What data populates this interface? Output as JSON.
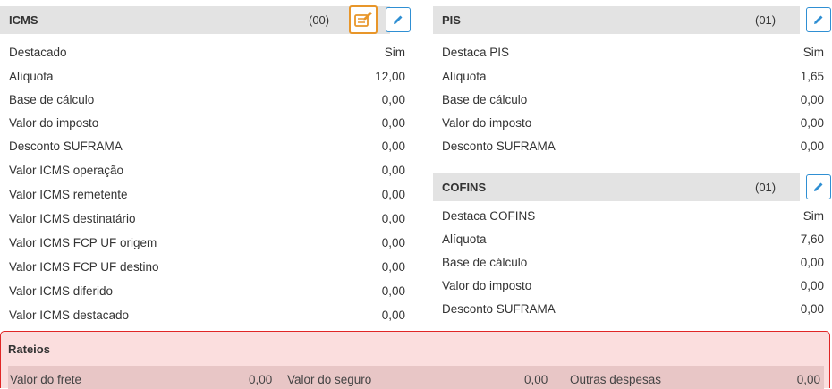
{
  "icms": {
    "title": "ICMS",
    "code": "(00)",
    "rows": [
      {
        "label": "Destacado",
        "value": "Sim"
      },
      {
        "label": "Alíquota",
        "value": "12,00"
      },
      {
        "label": "Base de cálculo",
        "value": "0,00"
      },
      {
        "label": "Valor do imposto",
        "value": "0,00"
      },
      {
        "label": "Desconto SUFRAMA",
        "value": "0,00"
      },
      {
        "label": "Valor ICMS operação",
        "value": "0,00"
      },
      {
        "label": "Valor ICMS remetente",
        "value": "0,00"
      },
      {
        "label": "Valor ICMS destinatário",
        "value": "0,00"
      },
      {
        "label": "Valor ICMS FCP UF origem",
        "value": "0,00"
      },
      {
        "label": "Valor ICMS FCP UF destino",
        "value": "0,00"
      },
      {
        "label": "Valor ICMS diferido",
        "value": "0,00"
      },
      {
        "label": "Valor ICMS destacado",
        "value": "0,00"
      }
    ]
  },
  "pis": {
    "title": "PIS",
    "code": "(01)",
    "rows": [
      {
        "label": "Destaca PIS",
        "value": "Sim"
      },
      {
        "label": "Alíquota",
        "value": "1,65"
      },
      {
        "label": "Base de cálculo",
        "value": "0,00"
      },
      {
        "label": "Valor do imposto",
        "value": "0,00"
      },
      {
        "label": "Desconto SUFRAMA",
        "value": "0,00"
      }
    ]
  },
  "cofins": {
    "title": "COFINS",
    "code": "(01)",
    "rows": [
      {
        "label": "Destaca COFINS",
        "value": "Sim"
      },
      {
        "label": "Alíquota",
        "value": "7,60"
      },
      {
        "label": "Base de cálculo",
        "value": "0,00"
      },
      {
        "label": "Valor do imposto",
        "value": "0,00"
      },
      {
        "label": "Desconto SUFRAMA",
        "value": "0,00"
      }
    ]
  },
  "rateios": {
    "title": "Rateios",
    "frete_label": "Valor do frete",
    "frete_value": "0,00",
    "seguro_label": "Valor do seguro",
    "seguro_value": "0,00",
    "outras_label": "Outras despesas",
    "outras_value": "0,00"
  },
  "icons": {
    "edit": "pencil-icon",
    "calc": "calculator-edit-icon"
  },
  "colors": {
    "header_bg": "#e3e3e3",
    "edit_blue": "#2f8fd3",
    "calc_orange": "#e8962a",
    "rateios_border": "#e02626",
    "rateios_bg": "#fbdede"
  }
}
